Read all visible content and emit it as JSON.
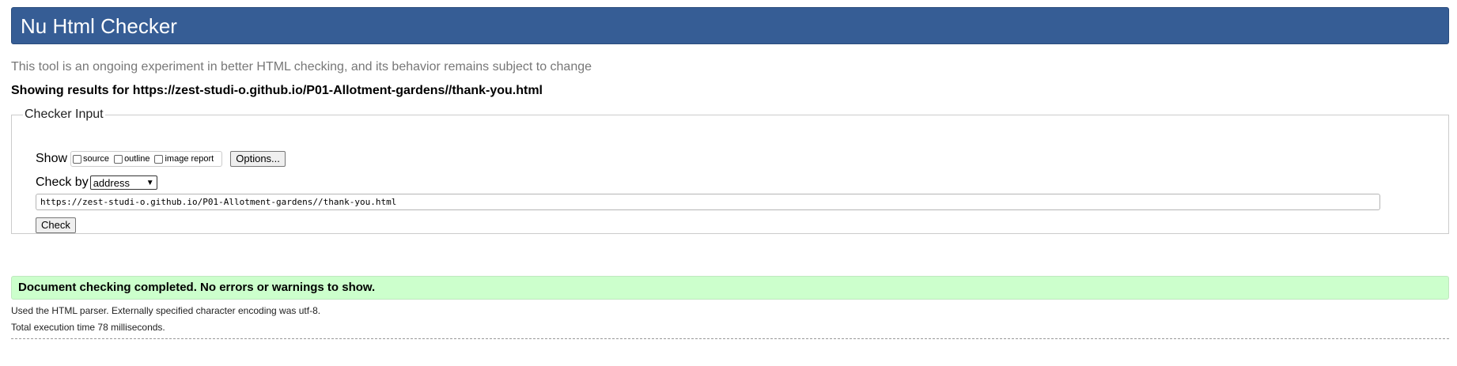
{
  "header": {
    "title": "Nu Html Checker",
    "background": "#365d95"
  },
  "tagline": "This tool is an ongoing experiment in better HTML checking, and its behavior remains subject to change",
  "results_for": "Showing results for https://zest-studi-o.github.io/P01-Allotment-gardens//thank-you.html",
  "checker_input": {
    "legend": "Checker Input",
    "show_label": "Show",
    "show_options": [
      {
        "label": "source",
        "checked": false
      },
      {
        "label": "outline",
        "checked": false
      },
      {
        "label": "image report",
        "checked": false
      }
    ],
    "options_button": "Options...",
    "check_by_label": "Check by",
    "check_by_value": "address",
    "url_value": "https://zest-studi-o.github.io/P01-Allotment-gardens//thank-you.html",
    "check_button": "Check"
  },
  "result": {
    "message": "Document checking completed. No errors or warnings to show.",
    "background": "#ccffcc",
    "details": [
      "Used the HTML parser. Externally specified character encoding was utf-8.",
      "Total execution time 78 milliseconds."
    ]
  }
}
